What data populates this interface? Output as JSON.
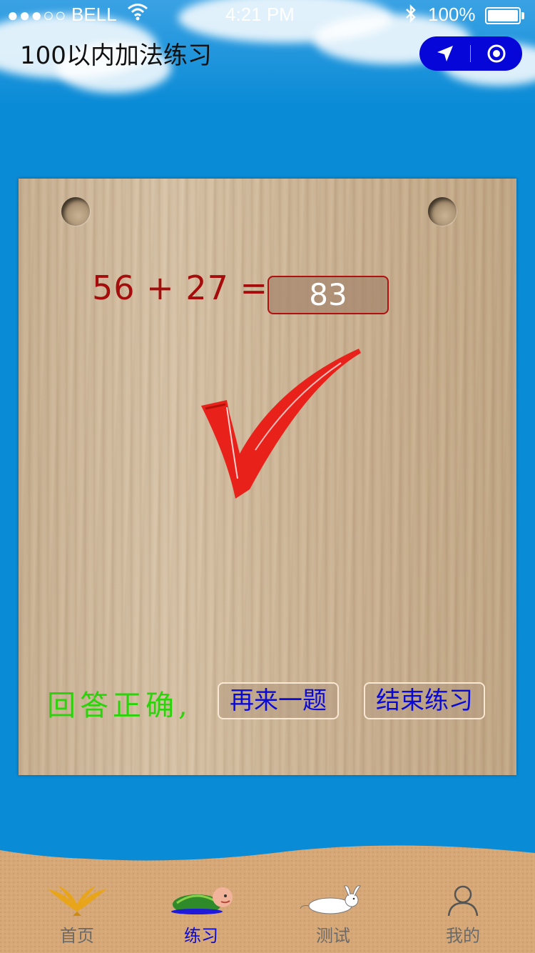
{
  "status_bar": {
    "signal": "●●●○○",
    "carrier": "BELL",
    "time": "4:21 PM",
    "battery": "100%"
  },
  "nav": {
    "title": "100以内加法练习"
  },
  "question": {
    "operand_a": "56",
    "operator": "+",
    "operand_b": "27",
    "equals": "=",
    "answer": "83"
  },
  "feedback": {
    "result_text": "回答正确,",
    "again_label": "再来一题",
    "end_label": "结束练习"
  },
  "tabs": [
    {
      "label": "首页",
      "icon": "eagle-icon",
      "active": false
    },
    {
      "label": "练习",
      "icon": "turtle-icon",
      "active": true
    },
    {
      "label": "测试",
      "icon": "rabbit-icon",
      "active": false
    },
    {
      "label": "我的",
      "icon": "person-icon",
      "active": false
    }
  ],
  "colors": {
    "background": "#0a8bd6",
    "capsule": "#0606d9",
    "equation": "#a50d0d",
    "correct": "#2bd40a",
    "button_text": "#0a0ad6",
    "active_tab": "#0a0ad6",
    "check": "#e8221a"
  }
}
